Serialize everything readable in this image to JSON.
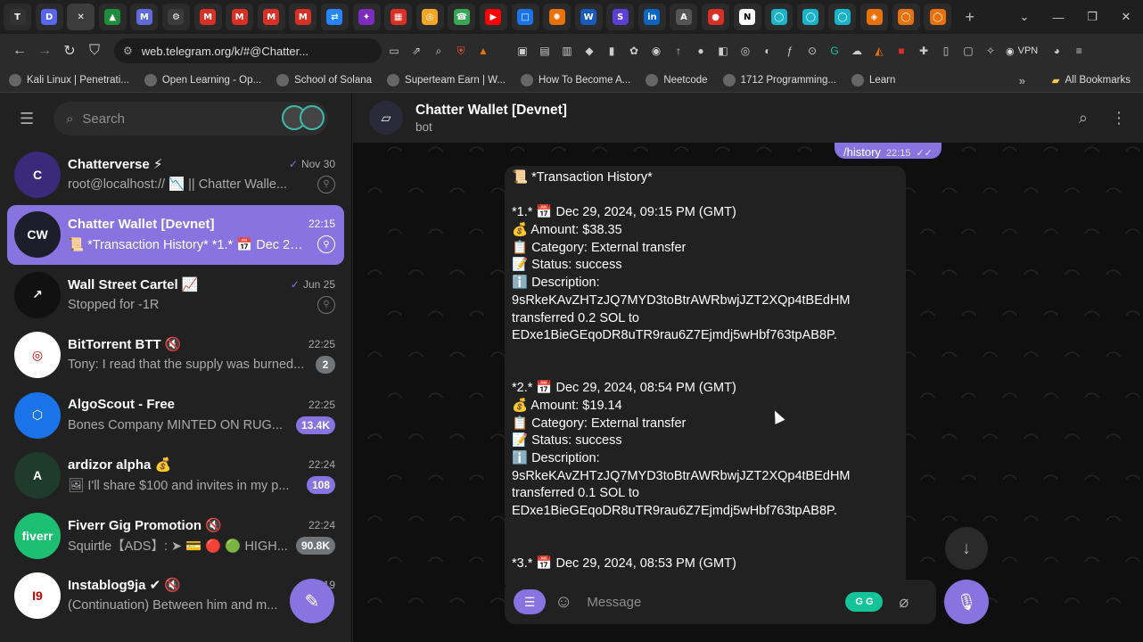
{
  "browser": {
    "tabs": [
      {
        "icon": "tldraw-icon",
        "label": "T",
        "color": "#333333"
      },
      {
        "icon": "discord-icon",
        "label": "D",
        "color": "#5865f2"
      },
      {
        "icon": "close-icon",
        "label": "✕",
        "color": "#3c3c3c"
      },
      {
        "icon": "google-drive-icon",
        "label": "▲",
        "color": "#1e8e3e"
      },
      {
        "icon": "gmail-icon",
        "label": "M",
        "color": "#5f6bd8"
      },
      {
        "icon": "chatgpt-icon",
        "label": "⚙",
        "color": "#3c3c3c"
      },
      {
        "icon": "gmail-icon",
        "label": "M",
        "color": "#d93025"
      },
      {
        "icon": "gmail-icon",
        "label": "M",
        "color": "#d93025"
      },
      {
        "icon": "gmail-icon",
        "label": "M",
        "color": "#d93025"
      },
      {
        "icon": "gmail-icon",
        "label": "M",
        "color": "#d93025"
      },
      {
        "icon": "jira-icon",
        "label": "⇄",
        "color": "#2684ff"
      },
      {
        "icon": "superteam-icon",
        "label": "✦",
        "color": "#7b2cbf"
      },
      {
        "icon": "app-icon",
        "label": "▦",
        "color": "#d93025"
      },
      {
        "icon": "bittorrent-icon",
        "label": "◎",
        "color": "#f5a623"
      },
      {
        "icon": "phone-icon",
        "label": "☎",
        "color": "#34a853"
      },
      {
        "icon": "youtube-icon",
        "label": "▶",
        "color": "#ff0000"
      },
      {
        "icon": "edit-icon",
        "label": "□",
        "color": "#1a73e8"
      },
      {
        "icon": "starburst-icon",
        "label": "✺",
        "color": "#e8710a"
      },
      {
        "icon": "word-icon",
        "label": "W",
        "color": "#185abd"
      },
      {
        "icon": "solana-icon",
        "label": "S",
        "color": "#5b3fd6"
      },
      {
        "icon": "linkedin-icon",
        "label": "in",
        "color": "#0a66c2"
      },
      {
        "icon": "openai-icon",
        "label": "A",
        "color": "#555555"
      },
      {
        "icon": "app-icon",
        "label": "●",
        "color": "#d93025"
      },
      {
        "icon": "notion-icon",
        "label": "N",
        "color": "#ffffff"
      },
      {
        "icon": "circle-icon",
        "label": "◯",
        "color": "#1ab3c8"
      },
      {
        "icon": "circle-icon",
        "label": "◯",
        "color": "#1ab3c8"
      },
      {
        "icon": "circle-icon",
        "label": "◯",
        "color": "#1ab3c8"
      },
      {
        "icon": "app-icon",
        "label": "◈",
        "color": "#e8710a"
      },
      {
        "icon": "circle-icon",
        "label": "◯",
        "color": "#e8710a"
      },
      {
        "icon": "circle-icon",
        "label": "◯",
        "color": "#e8710a"
      }
    ],
    "new_tab": "+",
    "url": "web.telegram.org/k/#@Chatter...",
    "vpn": "VPN",
    "bookmarks": [
      {
        "label": "Kali Linux | Penetrati...",
        "icon": "kali-icon"
      },
      {
        "label": "Open Learning - Op...",
        "icon": "shield-icon"
      },
      {
        "label": "School of Solana",
        "icon": "github-icon"
      },
      {
        "label": "Superteam Earn | W...",
        "icon": "superteam-icon"
      },
      {
        "label": "How To Become A...",
        "icon": "globe-icon"
      },
      {
        "label": "Neetcode",
        "icon": "flame-icon"
      },
      {
        "label": "1712 Programming...",
        "icon": "bracket-icon"
      },
      {
        "label": "Learn",
        "icon": "globe-icon"
      }
    ],
    "all_bookmarks": "All Bookmarks"
  },
  "sidebar": {
    "search_placeholder": "Search",
    "chats": [
      {
        "name": "Chatterverse ⚡",
        "time": "Nov 30",
        "preview": "root@localhost:// 📉 || Chatter Walle...",
        "avatar_color": "#3a2a7a",
        "avatar_text": "C",
        "check": "✓",
        "badge": "",
        "pinned": true,
        "active": false
      },
      {
        "name": "Chatter Wallet [Devnet]",
        "time": "22:15",
        "preview": "📜 *Transaction History* *1.* 📅 Dec 29, ...",
        "avatar_color": "#1e1e2a",
        "avatar_text": "CW",
        "check": "",
        "badge": "",
        "pinned": true,
        "active": true
      },
      {
        "name": "Wall Street Cartel 📈",
        "time": "Jun 25",
        "preview": "Stopped for -1R",
        "avatar_color": "#111111",
        "avatar_text": "↗",
        "check": "✓",
        "badge": "",
        "pinned": true,
        "active": false
      },
      {
        "name": "BitTorrent BTT 🔇",
        "time": "22:25",
        "preview": "Tony: I read that the supply was burned...",
        "avatar_color": "#ffffff",
        "avatar_text": "◎",
        "check": "",
        "badge": "2",
        "pinned": false,
        "active": false
      },
      {
        "name": "AlgoScout - Free",
        "time": "22:25",
        "preview": "Bones Company MINTED ON RUG...",
        "avatar_color": "#1a73e8",
        "avatar_text": "⬡",
        "check": "",
        "badge": "13.4K",
        "pinned": false,
        "active": false
      },
      {
        "name": "ardizor alpha 💰",
        "time": "22:24",
        "preview": "🖼 I'll share $100 and invites in my p...",
        "avatar_color": "#1f3b2c",
        "avatar_text": "A",
        "check": "",
        "badge": "108",
        "pinned": false,
        "active": false
      },
      {
        "name": "Fiverr Gig Promotion 🔇",
        "time": "22:24",
        "preview": "Squirtle【ADS】: ➤ 💳 🔴 🟢 HIGH...",
        "avatar_color": "#1dbf73",
        "avatar_text": "fiverr",
        "check": "",
        "badge": "90.8K",
        "pinned": false,
        "active": false
      },
      {
        "name": "Instablog9ja ✔ 🔇",
        "time": "22:19",
        "preview": "(Continuation) Between him and m...",
        "avatar_color": "#ffffff",
        "avatar_text": "I9",
        "check": "",
        "badge": "",
        "pinned": false,
        "active": false
      }
    ],
    "compose_icon": "✎"
  },
  "chat": {
    "title": "Chatter Wallet [Devnet]",
    "subtitle": "bot",
    "outgoing": {
      "text": "/history",
      "time": "22:15"
    },
    "message_lines": [
      "📜 *Transaction History*",
      "",
      "*1.* 📅 Dec 29, 2024, 09:15 PM (GMT)",
      "💰 Amount: $38.35",
      "📋 Category: External transfer",
      "📝 Status: success",
      "ℹ️ Description:",
      "9sRkeKAvZHTzJQ7MYD3toBtrAWRbwjJZT2XQp4tBEdHM",
      "transferred 0.2 SOL to",
      "EDxe1BieGEqoDR8uTR9rau6Z7Ejmdj5wHbf763tpAB8P.",
      "",
      "",
      "*2.* 📅 Dec 29, 2024, 08:54 PM (GMT)",
      "💰 Amount: $19.14",
      "📋 Category: External transfer",
      "📝 Status: success",
      "ℹ️ Description:",
      "9sRkeKAvZHTzJQ7MYD3toBtrAWRbwjJZT2XQp4tBEdHM",
      "transferred 0.1 SOL to",
      "EDxe1BieGEqoDR8uTR9rau6Z7Ejmdj5wHbf763tpAB8P.",
      "",
      "",
      "*3.* 📅 Dec 29, 2024, 08:53 PM (GMT)"
    ],
    "input_placeholder": "Message",
    "accent": "#8774e1"
  }
}
